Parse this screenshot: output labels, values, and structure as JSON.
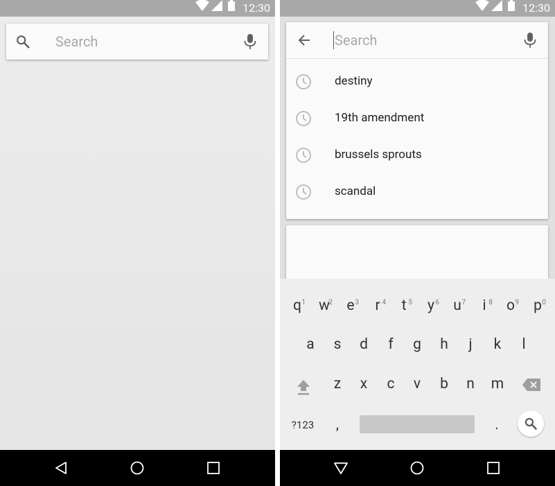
{
  "status": {
    "time": "12:30"
  },
  "left": {
    "search": {
      "placeholder": "Search"
    }
  },
  "right": {
    "search": {
      "placeholder": "Search"
    },
    "suggestions": [
      {
        "label": "destiny"
      },
      {
        "label": "19th amendment"
      },
      {
        "label": "brussels sprouts"
      },
      {
        "label": "scandal"
      }
    ],
    "keyboard": {
      "row1": [
        {
          "k": "q",
          "h": "1"
        },
        {
          "k": "w",
          "h": "2"
        },
        {
          "k": "e",
          "h": "3"
        },
        {
          "k": "r",
          "h": "4"
        },
        {
          "k": "t",
          "h": "5"
        },
        {
          "k": "y",
          "h": "6"
        },
        {
          "k": "u",
          "h": "7"
        },
        {
          "k": "i",
          "h": "8"
        },
        {
          "k": "o",
          "h": "9"
        },
        {
          "k": "p",
          "h": "0"
        }
      ],
      "row2": [
        "a",
        "s",
        "d",
        "f",
        "g",
        "h",
        "j",
        "k",
        "l"
      ],
      "row3": [
        "z",
        "x",
        "c",
        "v",
        "b",
        "n",
        "m"
      ],
      "symbols_label": "?123",
      "comma": ",",
      "period": "."
    }
  },
  "colors": {
    "status_bar": "#a8a8a8",
    "nav_bar": "#000000",
    "card": "#fafafa",
    "icon_gray": "#757575",
    "history_icon": "#bdbdbd"
  },
  "icons": [
    "wifi-icon",
    "cell-signal-icon",
    "battery-icon",
    "search-icon",
    "mic-icon",
    "back-arrow-icon",
    "history-icon",
    "shift-icon",
    "backspace-icon",
    "nav-back-icon",
    "nav-home-icon",
    "nav-recents-icon",
    "nav-collapse-icon"
  ]
}
